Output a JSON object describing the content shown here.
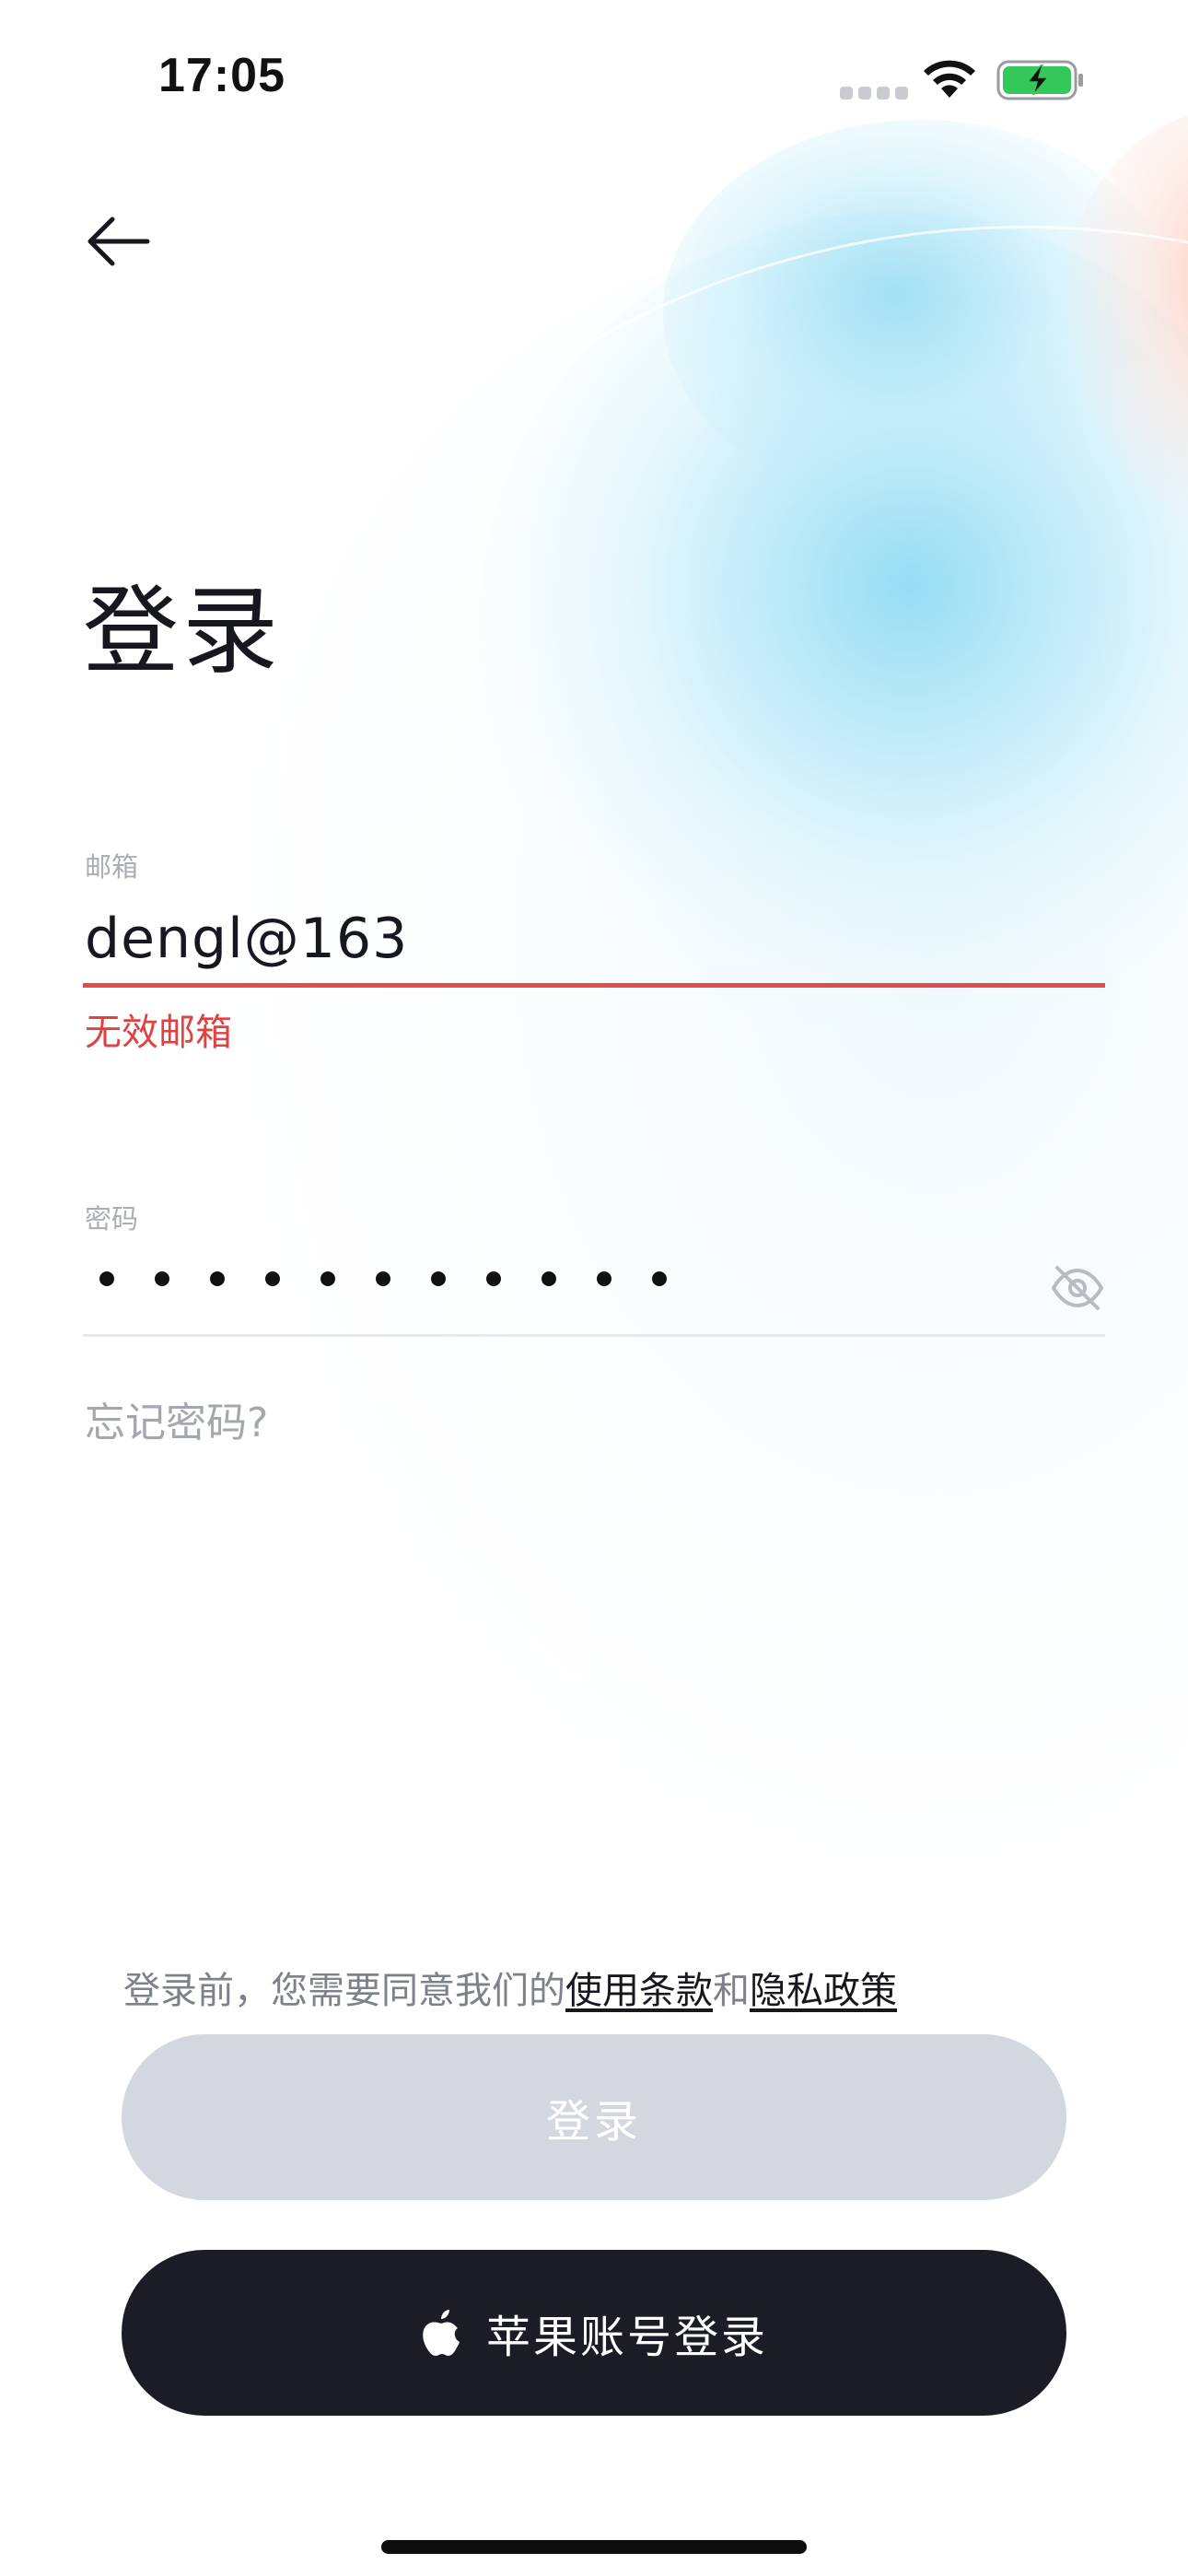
{
  "status_bar": {
    "time": "17:05",
    "icons": [
      "cellular-signal-icon",
      "wifi-icon",
      "battery-charging-icon"
    ]
  },
  "header": {
    "back_icon": "arrow-left-icon"
  },
  "page": {
    "title": "登录"
  },
  "email": {
    "label": "邮箱",
    "value": "dengl@163",
    "error": "无效邮箱",
    "error_color": "#e04141"
  },
  "password": {
    "label": "密码",
    "masked_length": 11,
    "visibility_icon": "eye-off-icon"
  },
  "forgot_password": "忘记密码?",
  "terms": {
    "prefix": "登录前，您需要同意我们的",
    "terms_link": "使用条款",
    "conjunction": "和",
    "privacy_link": "隐私政策"
  },
  "buttons": {
    "login": "登录",
    "apple_login": "苹果账号登录",
    "apple_icon": "apple-logo-icon"
  },
  "colors": {
    "primary_dark": "#1b1c26",
    "disabled_button": "#d3d8e0",
    "accent_blue": "#91dbf2"
  }
}
